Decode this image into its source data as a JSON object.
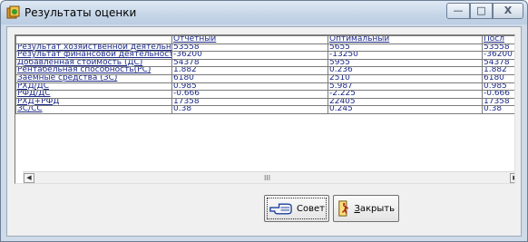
{
  "window": {
    "title": "Результаты оценки",
    "controls": {
      "minimize": "—",
      "maximize": "□",
      "close": "X"
    }
  },
  "grid": {
    "columns": [
      "",
      "Отчетный",
      "Оптимальный",
      "Посл"
    ],
    "rows": [
      [
        "Результат хозяйственной деятельности",
        "53558",
        "5655",
        "53558"
      ],
      [
        "Результат финансовой деятельности",
        "-36200",
        "-13250",
        "-36200"
      ],
      [
        "Добавленная стоимость (ДС)",
        "54378",
        "5955",
        "54378"
      ],
      [
        "Рентабельная способность(РС)",
        "1.882",
        "0.236",
        "1.882"
      ],
      [
        "Заемные средства (ЗС)",
        "6180",
        "2510",
        "6180"
      ],
      [
        "РХД/ДС",
        "0.985",
        "5.987",
        "0.985"
      ],
      [
        "РФД/ДС",
        "-0.666",
        "-2.225",
        "-0.666"
      ],
      [
        "РХД+РФД",
        "17358",
        "22405",
        "17358"
      ],
      [
        "ЗС/СС",
        "0.38",
        "0.245",
        "0.38"
      ]
    ]
  },
  "scrollbar": {
    "left_arrow": "◀",
    "right_arrow": "▶",
    "thumb_grip": "III"
  },
  "buttons": {
    "advice": {
      "label": "Совет",
      "icon": "hand-pointing-icon"
    },
    "close": {
      "label": "Закрыть",
      "accel_char": "З",
      "label_rest": "акрыть",
      "icon": "door-exit-icon"
    }
  },
  "colors": {
    "cell_text": "#1c2a88",
    "title_bar": "#c5d5e7",
    "client_bg": "#f0f0f0"
  }
}
